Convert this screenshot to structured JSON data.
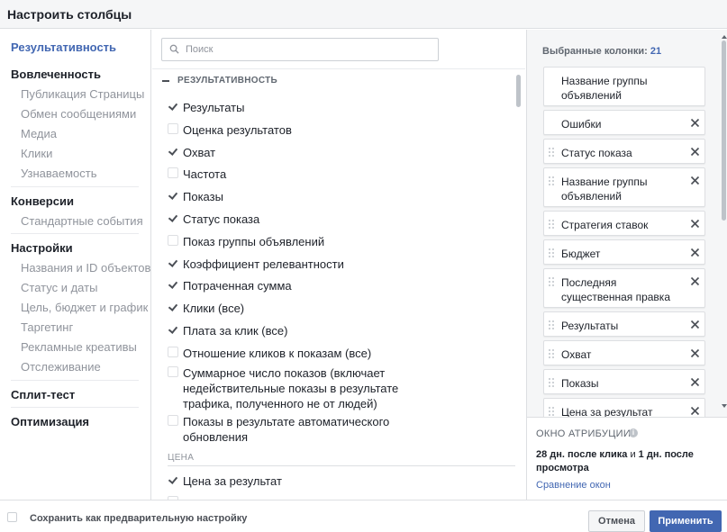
{
  "window": {
    "title": "Настроить столбцы"
  },
  "nav": {
    "groups": [
      {
        "label": "Результативность",
        "active": true,
        "items": []
      },
      {
        "label": "Вовлеченность",
        "items": [
          "Публикация Страницы",
          "Обмен сообщениями",
          "Медиа",
          "Клики",
          "Узнаваемость"
        ]
      },
      {
        "label": "Конверсии",
        "items": [
          "Стандартные события"
        ]
      },
      {
        "label": "Настройки",
        "items": [
          "Названия и ID объектов",
          "Статус и даты",
          "Цель, бюджет и график",
          "Таргетинг",
          "Рекламные креативы",
          "Отслеживание"
        ]
      },
      {
        "label": "Сплит-тест",
        "items": []
      },
      {
        "label": "Оптимизация",
        "items": []
      }
    ]
  },
  "search": {
    "placeholder": "Поиск",
    "icon": "search-icon"
  },
  "columns": {
    "section_label": "РЕЗУЛЬТАТИВНОСТЬ",
    "items": [
      {
        "label": "Результаты",
        "checked": true
      },
      {
        "label": "Оценка результатов",
        "checked": false
      },
      {
        "label": "Охват",
        "checked": true
      },
      {
        "label": "Частота",
        "checked": false
      },
      {
        "label": "Показы",
        "checked": true
      },
      {
        "label": "Статус показа",
        "checked": true
      },
      {
        "label": "Показ группы объявлений",
        "checked": false
      },
      {
        "label": "Коэффициент релевантности",
        "checked": true
      },
      {
        "label": "Потраченная сумма",
        "checked": true
      },
      {
        "label": "Клики (все)",
        "checked": true
      },
      {
        "label": "Плата за клик (все)",
        "checked": true
      },
      {
        "label": "Отношение кликов к показам (все)",
        "checked": false
      },
      {
        "label": "Суммарное число показов (включает недействительные показы в результате трафика, полученного не от людей)",
        "checked": false
      },
      {
        "label": "Показы в результате автоматического обновления",
        "checked": false
      }
    ],
    "price_section_label": "ЦЕНА",
    "price_items": [
      {
        "label": "Цена за результат",
        "checked": true
      }
    ]
  },
  "selected": {
    "title": "Выбранные колонки:",
    "count": "21",
    "items": [
      {
        "label": "Название группы объявлений",
        "draggable": false,
        "removable": false
      },
      {
        "label": "Ошибки",
        "draggable": false,
        "removable": true
      },
      {
        "label": "Статус показа",
        "draggable": true,
        "removable": true
      },
      {
        "label": "Название группы объявлений",
        "draggable": true,
        "removable": true
      },
      {
        "label": "Стратегия ставок",
        "draggable": true,
        "removable": true
      },
      {
        "label": "Бюджет",
        "draggable": true,
        "removable": true
      },
      {
        "label": "Последняя существенная правка",
        "draggable": true,
        "removable": true
      },
      {
        "label": "Результаты",
        "draggable": true,
        "removable": true
      },
      {
        "label": "Охват",
        "draggable": true,
        "removable": true
      },
      {
        "label": "Показы",
        "draggable": true,
        "removable": true
      },
      {
        "label": "Цена за результат",
        "draggable": true,
        "removable": true
      }
    ]
  },
  "attribution": {
    "title": "ОКНО АТРИБУЦИИ",
    "info_icon": "info-icon",
    "desc_part1": "28 дн. после клика",
    "desc_and": " и ",
    "desc_part2": "1 дн. после просмотра",
    "link": "Сравнение окон"
  },
  "footer": {
    "save_preset_label": "Сохранить как предварительную настройку",
    "cancel_label": "Отмена",
    "apply_label": "Применить"
  },
  "colors": {
    "accent": "#4267b2",
    "header_bg": "#f5f6f7",
    "muted": "#90949c"
  }
}
